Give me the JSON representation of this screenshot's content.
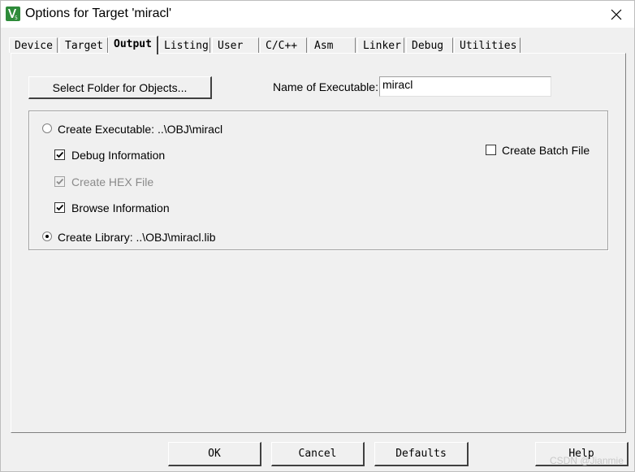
{
  "window": {
    "title": "Options for Target 'miracl'",
    "app_icon": "keil-uvision-icon",
    "close_icon": "close-icon"
  },
  "tabs": [
    {
      "label": "Device",
      "active": false
    },
    {
      "label": "Target",
      "active": false
    },
    {
      "label": "Output",
      "active": true
    },
    {
      "label": "Listing",
      "active": false
    },
    {
      "label": "User",
      "active": false
    },
    {
      "label": "C/C++",
      "active": false
    },
    {
      "label": "Asm",
      "active": false
    },
    {
      "label": "Linker",
      "active": false
    },
    {
      "label": "Debug",
      "active": false
    },
    {
      "label": "Utilities",
      "active": false
    }
  ],
  "output": {
    "select_folder_label": "Select Folder for Objects...",
    "name_of_executable_label": "Name of Executable:",
    "name_of_executable_value": "miracl",
    "create_executable_label": "Create Executable:  ..\\OBJ\\miracl",
    "create_executable_selected": false,
    "debug_information_label": "Debug Information",
    "debug_information_checked": true,
    "create_hex_label": "Create HEX File",
    "create_hex_checked": true,
    "browse_information_label": "Browse Information",
    "browse_information_checked": true,
    "create_library_label": "Create Library:  ..\\OBJ\\miracl.lib",
    "create_library_selected": true,
    "create_batch_file_label": "Create Batch File",
    "create_batch_file_checked": false
  },
  "footer": {
    "ok_label": "OK",
    "cancel_label": "Cancel",
    "defaults_label": "Defaults",
    "help_label": "Help"
  },
  "watermark": "CSDN @Jianmie",
  "colors": {
    "background": "#f0f0f0",
    "titlebar": "#ffffff",
    "disabled_text": "#8a8a8a"
  }
}
